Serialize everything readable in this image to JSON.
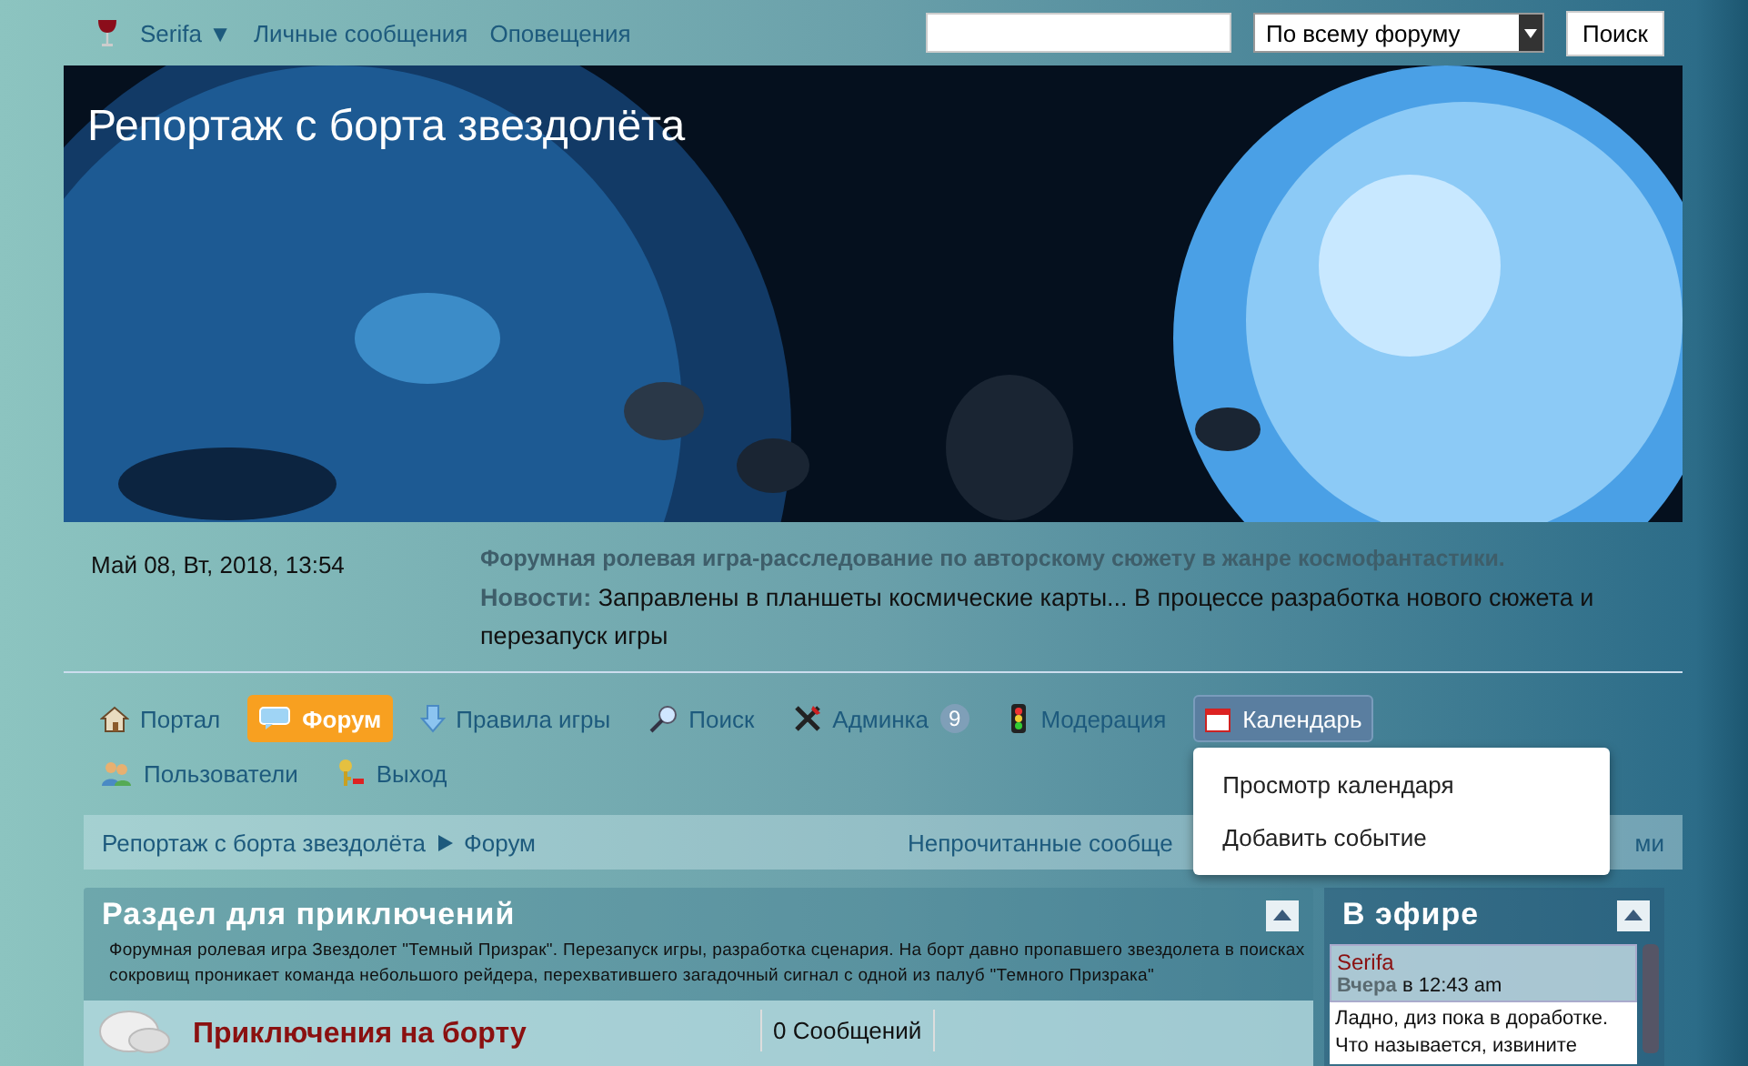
{
  "topbar": {
    "user": "Serifa ▼",
    "links": [
      "Личные сообщения",
      "Оповещения"
    ],
    "search_scope": "По всему форуму",
    "search_button": "Поиск"
  },
  "banner": {
    "title": "Репортаж с борта звездолёта"
  },
  "info": {
    "datetime": "Май 08, Вт, 2018, 13:54",
    "tagline": "Форумная ролевая игра-расследование по авторскому сюжету в жанре космофантастики.",
    "news": "**Новости:**  Заправлены в планшеты космические карты... В процессе разработка нового сюжета и перезапуск игры"
  },
  "nav": [
    {
      "label": "Портал",
      "selected": false
    },
    {
      "label": "Форум",
      "selected": true
    },
    {
      "label": "Правила игры",
      "selected": false
    },
    {
      "label": "Поиск",
      "selected": false
    },
    {
      "label": "Админка",
      "selected": false,
      "badge": "9"
    },
    {
      "label": "Модерация",
      "selected": false
    },
    {
      "label": "Календарь",
      "selected": false,
      "expanded": true
    },
    {
      "label": "Пользователи",
      "selected": false
    },
    {
      "label": "Выход",
      "selected": false
    }
  ],
  "menu": [
    "Просмотр календаря",
    "Добавить событие"
  ],
  "breadcrumb": {
    "items": [
      "Репортаж с борта звездолёта",
      "Форум"
    ],
    "right_start": "Непрочитанные сообще",
    "right_end": "ми"
  },
  "section": {
    "title": "Раздел для приключений",
    "description": "Форумная ролевая игра Звездолет \"Темный Призрак\". Перезапуск игры, разработка сценария. На борт давно пропавшего звездолета в поисках сокровищ проникает команда небольшого рейдера, перехватившего загадочный сигнал с одной из палуб \"Темного Призрака\"",
    "board": "Приключения на борту",
    "posts": "0 Сообщений"
  },
  "sidebar": {
    "title": "В эфире",
    "author": "Serifa",
    "when_label": "Вчера",
    "when": "в 12:43 am",
    "message": "Ладно, диз пока в доработке. Что называется, извините"
  }
}
